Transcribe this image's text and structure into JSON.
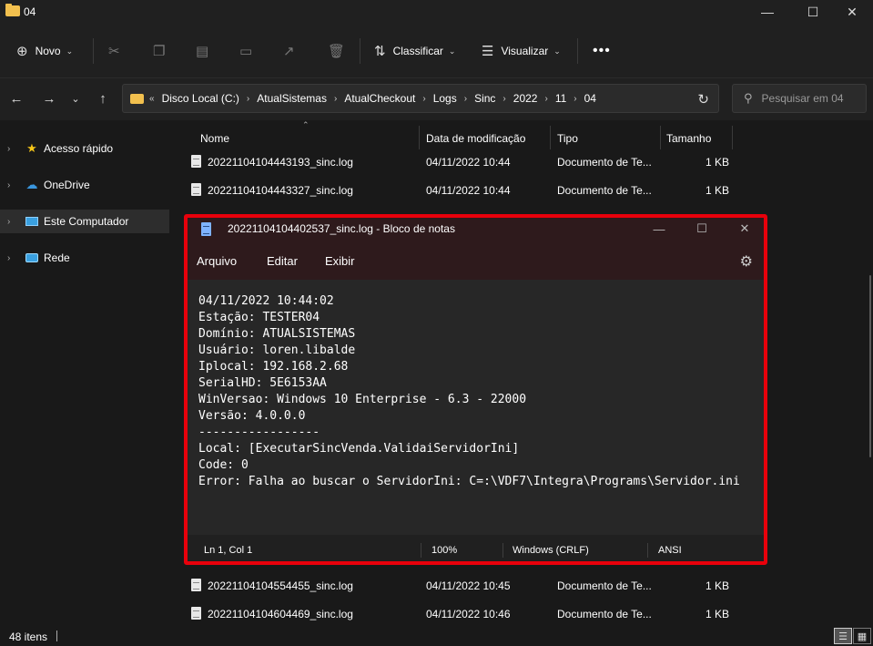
{
  "window": {
    "title": "04",
    "minimize_icon": "minimize-icon",
    "maximize_icon": "maximize-icon",
    "close_icon": "close-icon"
  },
  "toolbar": {
    "new_label": "Novo",
    "sort_label": "Classificar",
    "view_label": "Visualizar"
  },
  "address": {
    "crumbs": [
      "Disco Local (C:)",
      "AtualSistemas",
      "AtualCheckout",
      "Logs",
      "Sinc",
      "2022",
      "11",
      "04"
    ]
  },
  "search": {
    "placeholder": "Pesquisar em 04"
  },
  "sidebar": {
    "items": [
      {
        "label": "Acesso rápido",
        "icon": "star-icon"
      },
      {
        "label": "OneDrive",
        "icon": "cloud-icon"
      },
      {
        "label": "Este Computador",
        "icon": "computer-icon"
      },
      {
        "label": "Rede",
        "icon": "network-icon"
      }
    ]
  },
  "columns": {
    "name": "Nome",
    "modified": "Data de modificação",
    "type": "Tipo",
    "size": "Tamanho"
  },
  "files": [
    {
      "name": "20221104104443193_sinc.log",
      "modified": "04/11/2022 10:44",
      "type": "Documento de Te...",
      "size": "1 KB"
    },
    {
      "name": "20221104104443327_sinc.log",
      "modified": "04/11/2022 10:44",
      "type": "Documento de Te...",
      "size": "1 KB"
    },
    {
      "name": "20221104104554455_sinc.log",
      "modified": "04/11/2022 10:45",
      "type": "Documento de Te...",
      "size": "1 KB"
    },
    {
      "name": "20221104104604469_sinc.log",
      "modified": "04/11/2022 10:46",
      "type": "Documento de Te...",
      "size": "1 KB"
    }
  ],
  "status": {
    "item_count": "48 itens"
  },
  "notepad": {
    "title": "20221104104402537_sinc.log - Bloco de notas",
    "menu": {
      "file": "Arquivo",
      "edit": "Editar",
      "view": "Exibir"
    },
    "lines": [
      "04/11/2022 10:44:02",
      "Estação: TESTER04",
      "Domínio: ATUALSISTEMAS",
      "Usuário: loren.libalde",
      "Iplocal: 192.168.2.68",
      "SerialHD: 5E6153AA",
      "WinVersao: Windows 10 Enterprise - 6.3 - 22000",
      "Versão: 4.0.0.0",
      "-----------------",
      "Local: [ExecutarSincVenda.ValidaiServidorIni]",
      "Code: 0",
      "Error: Falha ao buscar o ServidorIni: C=:\\VDF7\\Integra\\Programs\\Servidor.ini"
    ],
    "status": {
      "position": "Ln 1, Col 1",
      "zoom": "100%",
      "line_ending": "Windows (CRLF)",
      "encoding": "ANSI"
    },
    "highlight_color": "#e8000b"
  }
}
